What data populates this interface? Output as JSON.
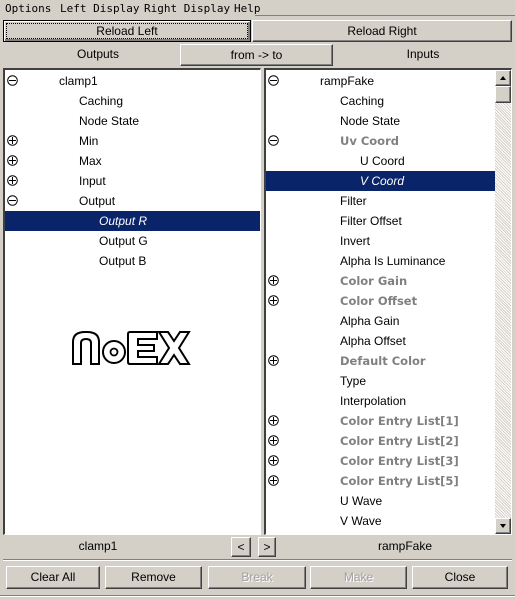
{
  "menu": [
    "Options",
    "Left Display",
    "Right Display",
    "Help"
  ],
  "toolbar": {
    "reload_left": "Reload Left",
    "reload_right": "Reload Right",
    "outputs_label": "Outputs",
    "direction_button": "from -> to",
    "inputs_label": "Inputs"
  },
  "left_panel": {
    "rows": [
      {
        "label": "clamp1",
        "expander": "collapse",
        "level": 0,
        "style": "normal"
      },
      {
        "label": "Caching",
        "expander": "none",
        "level": 1,
        "style": "normal"
      },
      {
        "label": "Node State",
        "expander": "none",
        "level": 1,
        "style": "normal"
      },
      {
        "label": "Min",
        "expander": "expand",
        "level": 1,
        "style": "normal"
      },
      {
        "label": "Max",
        "expander": "expand",
        "level": 1,
        "style": "normal"
      },
      {
        "label": "Input",
        "expander": "expand",
        "level": 1,
        "style": "normal"
      },
      {
        "label": "Output",
        "expander": "collapse",
        "level": 1,
        "style": "normal"
      },
      {
        "label": "Output R",
        "expander": "none",
        "level": 2,
        "style": "selected"
      },
      {
        "label": "Output G",
        "expander": "none",
        "level": 2,
        "style": "normal"
      },
      {
        "label": "Output B",
        "expander": "none",
        "level": 2,
        "style": "normal"
      }
    ],
    "logo_text": "NoEX"
  },
  "right_panel": {
    "rows": [
      {
        "label": "rampFake",
        "expander": "collapse",
        "level": 0,
        "style": "normal"
      },
      {
        "label": "Caching",
        "expander": "none",
        "level": 1,
        "style": "normal"
      },
      {
        "label": "Node State",
        "expander": "none",
        "level": 1,
        "style": "normal"
      },
      {
        "label": "Uv Coord",
        "expander": "collapse",
        "level": 1,
        "style": "grey"
      },
      {
        "label": "U Coord",
        "expander": "none",
        "level": 2,
        "style": "normal"
      },
      {
        "label": "V Coord",
        "expander": "none",
        "level": 2,
        "style": "selected"
      },
      {
        "label": "Filter",
        "expander": "none",
        "level": 1,
        "style": "normal"
      },
      {
        "label": "Filter Offset",
        "expander": "none",
        "level": 1,
        "style": "normal"
      },
      {
        "label": "Invert",
        "expander": "none",
        "level": 1,
        "style": "normal"
      },
      {
        "label": "Alpha Is Luminance",
        "expander": "none",
        "level": 1,
        "style": "normal"
      },
      {
        "label": "Color Gain",
        "expander": "expand",
        "level": 1,
        "style": "grey"
      },
      {
        "label": "Color Offset",
        "expander": "expand",
        "level": 1,
        "style": "grey"
      },
      {
        "label": "Alpha Gain",
        "expander": "none",
        "level": 1,
        "style": "normal"
      },
      {
        "label": "Alpha Offset",
        "expander": "none",
        "level": 1,
        "style": "normal"
      },
      {
        "label": "Default Color",
        "expander": "expand",
        "level": 1,
        "style": "grey"
      },
      {
        "label": "Type",
        "expander": "none",
        "level": 1,
        "style": "normal"
      },
      {
        "label": "Interpolation",
        "expander": "none",
        "level": 1,
        "style": "normal"
      },
      {
        "label": "Color Entry List[1]",
        "expander": "expand",
        "level": 1,
        "style": "grey"
      },
      {
        "label": "Color Entry List[2]",
        "expander": "expand",
        "level": 1,
        "style": "grey"
      },
      {
        "label": "Color Entry List[3]",
        "expander": "expand",
        "level": 1,
        "style": "grey"
      },
      {
        "label": "Color Entry List[5]",
        "expander": "expand",
        "level": 1,
        "style": "grey"
      },
      {
        "label": "U Wave",
        "expander": "none",
        "level": 1,
        "style": "normal"
      },
      {
        "label": "V Wave",
        "expander": "none",
        "level": 1,
        "style": "normal"
      }
    ]
  },
  "footer": {
    "left_node": "clamp1",
    "prev_button": "<",
    "next_button": ">",
    "right_node": "rampFake"
  },
  "actions": {
    "clear_all": "Clear All",
    "remove": "Remove",
    "break": "Break",
    "make": "Make",
    "close": "Close"
  },
  "colors": {
    "selection": "#0a246a",
    "window_bg": "#d4d0c8",
    "grey_text": "#808080"
  }
}
